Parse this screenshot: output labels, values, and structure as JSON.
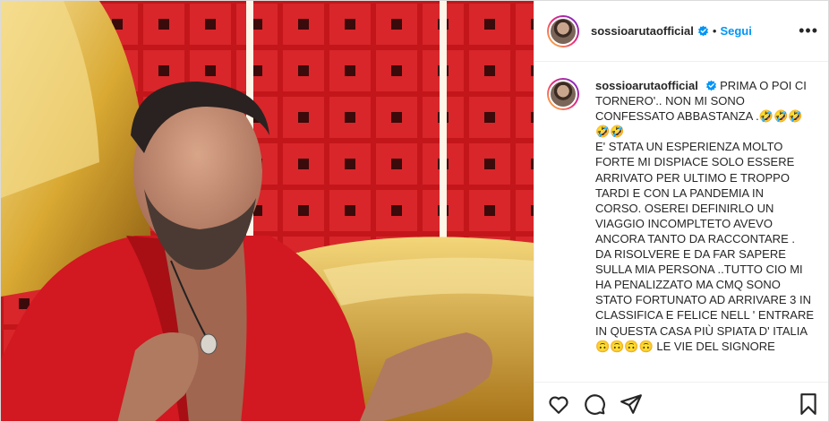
{
  "post": {
    "username": "sossioarutaofficial",
    "separator": "•",
    "follow_label": "Segui",
    "more_label": "•••",
    "caption": {
      "username": "sossioarutaofficial",
      "lines": [
        "PRIMA O POI CI",
        "TORNERO'.. NON MI SONO",
        "CONFESSATO ABBASTANZA .🤣🤣🤣",
        "🤣🤣",
        "E' STATA UN ESPERIENZA MOLTO",
        "FORTE MI DISPIACE SOLO ESSERE",
        "ARRIVATO PER ULTIMO E TROPPO",
        "TARDI E CON LA PANDEMIA IN",
        "CORSO. OSEREI DEFINIRLO UN",
        "VIAGGIO INCOMPLTETO AVEVO",
        "ANCORA TANTO DA RACCONTARE .",
        "DA RISOLVERE E DA FAR SAPERE",
        "SULLA MIA PERSONA ..TUTTO CIO MI",
        "HA PENALIZZATO MA CMQ SONO",
        "STATO FORTUNATO AD ARRIVARE 3 IN",
        "CLASSIFICA E FELICE NELL ' ENTRARE",
        "IN QUESTA CASA PIÙ SPIATA D' ITALIA",
        "🙃🙃🙃🙃 LE VIE DEL SIGNORE"
      ]
    }
  },
  "icons": {
    "like": "heart-icon",
    "comment": "comment-icon",
    "share": "share-icon",
    "save": "bookmark-icon",
    "verified": "verified-badge-icon"
  },
  "colors": {
    "follow_blue": "#0095f6",
    "verified_blue": "#0095f6",
    "text": "#262626",
    "border": "#efefef",
    "photo_red": "#b31217",
    "gold": "#d9a933"
  }
}
